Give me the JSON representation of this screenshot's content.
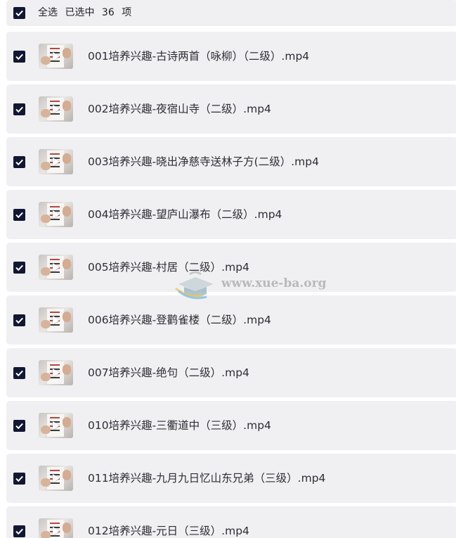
{
  "header": {
    "select_all_label": "全选",
    "selected_prefix": "已选中",
    "selected_count": "36",
    "selected_suffix": "项"
  },
  "items": [
    {
      "title": "001培养兴趣-古诗两首（咏柳）（二级）.mp4",
      "checked": true
    },
    {
      "title": "002培养兴趣-夜宿山寺（二级）.mp4",
      "checked": true
    },
    {
      "title": "003培养兴趣-晓出净慈寺送林子方(二级）.mp4",
      "checked": true
    },
    {
      "title": "004培养兴趣-望庐山瀑布（二级）.mp4",
      "checked": true
    },
    {
      "title": "005培养兴趣-村居（二级）.mp4",
      "checked": true
    },
    {
      "title": "006培养兴趣-登鹳雀楼（二级）.mp4",
      "checked": true
    },
    {
      "title": "007培养兴趣-绝句（二级）.mp4",
      "checked": true
    },
    {
      "title": "010培养兴趣-三衢道中（三级）.mp4",
      "checked": true
    },
    {
      "title": "011培养兴趣-九月九日忆山东兄弟（三级）.mp4",
      "checked": true
    },
    {
      "title": "012培养兴趣-元日（三级）.mp4",
      "checked": true
    }
  ],
  "watermark": {
    "text": "www.xue-ba.org"
  },
  "colors": {
    "checkbox": "#121733",
    "card_background": "#f0f0f3",
    "text": "#2d2d35"
  }
}
